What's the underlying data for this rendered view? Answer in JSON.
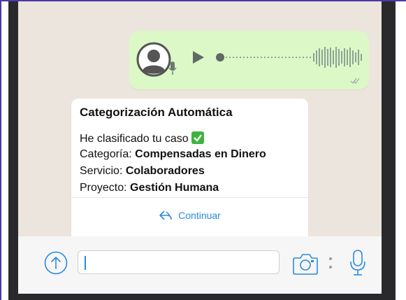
{
  "voice_message": {
    "avatar_icon": "user-avatar-icon",
    "mic_icon": "microphone-icon",
    "play_icon": "play-icon",
    "status_icon": "double-check-icon"
  },
  "card": {
    "title": "Categorización Automática",
    "classified_text": "He clasificado tu caso",
    "classified_icon": "check-mark-button-icon",
    "category_label": "Categoría:",
    "category_value": "Compensadas en Dinero",
    "service_label": "Servicio:",
    "service_value": "Colaboradores",
    "project_label": "Proyecto:",
    "project_value": "Gestión Humana",
    "continue_label": "Continuar",
    "continue_icon": "reply-arrow-icon"
  },
  "composer": {
    "upload_icon": "upload-arrow-icon",
    "input_value": "",
    "camera_icon": "camera-icon",
    "more_icon": "vertical-dots-icon",
    "mic_icon": "microphone-icon"
  },
  "colors": {
    "chat_background": "#ece5dd",
    "outgoing_bubble": "#dcf8c6",
    "accent": "#2a8ae0",
    "check_green": "#3cb43c"
  }
}
